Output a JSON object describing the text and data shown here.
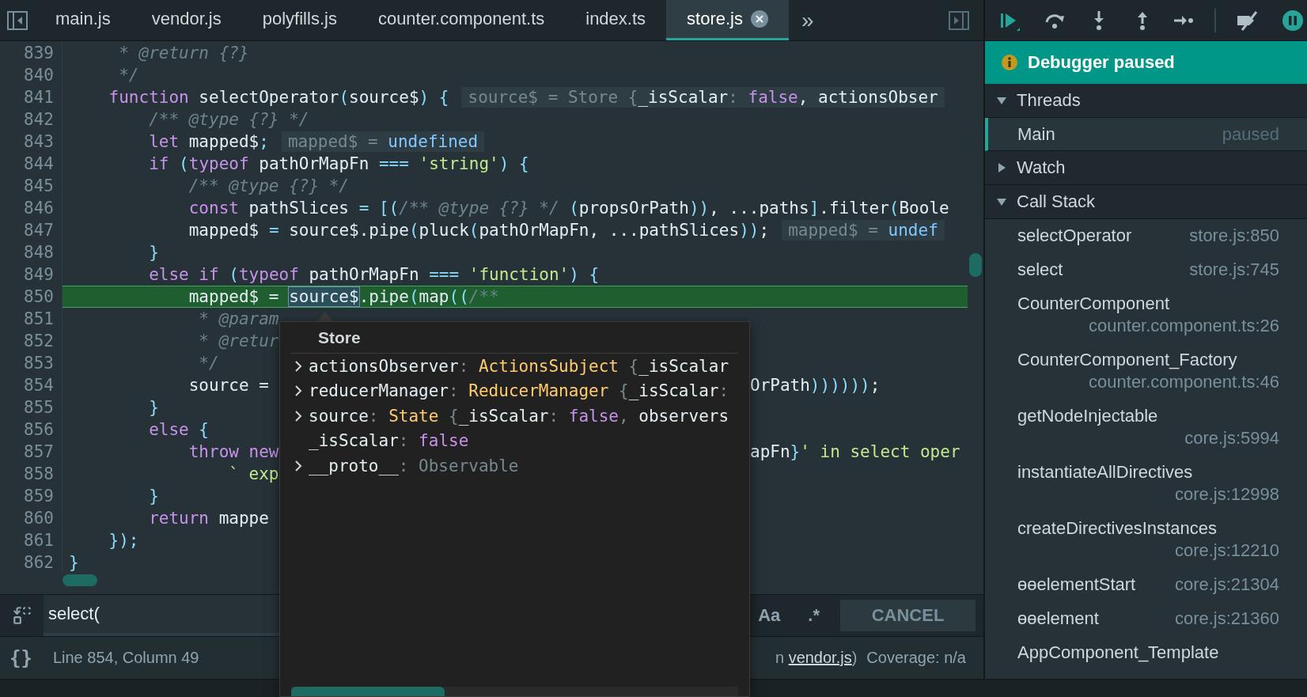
{
  "tabs": [
    {
      "label": "main.js",
      "selected": false,
      "closable": false
    },
    {
      "label": "vendor.js",
      "selected": false,
      "closable": false
    },
    {
      "label": "polyfills.js",
      "selected": false,
      "closable": false
    },
    {
      "label": "counter.component.ts",
      "selected": false,
      "closable": false
    },
    {
      "label": "index.ts",
      "selected": false,
      "closable": false
    },
    {
      "label": "store.js",
      "selected": true,
      "closable": true
    }
  ],
  "overflow_button": "»",
  "editor": {
    "lines": [
      {
        "number": "839",
        "highlighted": false,
        "tokens": [
          {
            "kind": "cm",
            "text": "     * @return {?}"
          }
        ]
      },
      {
        "number": "840",
        "highlighted": false,
        "tokens": [
          {
            "kind": "cm",
            "text": "     */"
          }
        ]
      },
      {
        "number": "841",
        "highlighted": false,
        "tokens": [
          {
            "kind": "kw",
            "text": "    function"
          },
          {
            "kind": "id",
            "text": " selectOperator"
          },
          {
            "kind": "p",
            "text": "("
          },
          {
            "kind": "id",
            "text": "source$"
          },
          {
            "kind": "p",
            "text": ") {"
          }
        ],
        "hint": [
          {
            "kind": "dim",
            "text": "source$ = Store {"
          },
          {
            "kind": "id",
            "text": "_isScalar"
          },
          {
            "kind": "dim",
            "text": ": "
          },
          {
            "kind": "kw",
            "text": "false"
          },
          {
            "kind": "id",
            "text": ", actionsObser"
          }
        ]
      },
      {
        "number": "842",
        "highlighted": false,
        "tokens": [
          {
            "kind": "cm",
            "text": "        /** @type {?} */"
          }
        ]
      },
      {
        "number": "843",
        "highlighted": false,
        "tokens": [
          {
            "kind": "kw",
            "text": "        let"
          },
          {
            "kind": "id",
            "text": " mapped$"
          },
          {
            "kind": "p",
            "text": ";"
          }
        ],
        "hint": [
          {
            "kind": "dim",
            "text": "mapped$ = "
          },
          {
            "kind": "lit",
            "text": "undefined"
          }
        ]
      },
      {
        "number": "844",
        "highlighted": false,
        "tokens": [
          {
            "kind": "kw",
            "text": "        if"
          },
          {
            "kind": "p",
            "text": " ("
          },
          {
            "kind": "kw",
            "text": "typeof"
          },
          {
            "kind": "id",
            "text": " pathOrMapFn "
          },
          {
            "kind": "p",
            "text": "==="
          },
          {
            "kind": "str",
            "text": " 'string'"
          },
          {
            "kind": "p",
            "text": ") {"
          }
        ]
      },
      {
        "number": "845",
        "highlighted": false,
        "tokens": [
          {
            "kind": "cm",
            "text": "            /** @type {?} */"
          }
        ]
      },
      {
        "number": "846",
        "highlighted": false,
        "tokens": [
          {
            "kind": "kw",
            "text": "            const"
          },
          {
            "kind": "id",
            "text": " pathSlices "
          },
          {
            "kind": "p",
            "text": "= [("
          },
          {
            "kind": "cm",
            "text": "/** @type {?} */"
          },
          {
            "kind": "p",
            "text": " ("
          },
          {
            "kind": "id",
            "text": "propsOrPath"
          },
          {
            "kind": "p",
            "text": "))"
          },
          {
            "kind": "id",
            "text": ", ...paths"
          },
          {
            "kind": "p",
            "text": "]"
          },
          {
            "kind": "id",
            "text": ".filter"
          },
          {
            "kind": "p",
            "text": "("
          },
          {
            "kind": "id",
            "text": "Boole"
          }
        ]
      },
      {
        "number": "847",
        "highlighted": false,
        "tokens": [
          {
            "kind": "id",
            "text": "            mapped$ "
          },
          {
            "kind": "p",
            "text": "="
          },
          {
            "kind": "id",
            "text": " source$.pipe"
          },
          {
            "kind": "p",
            "text": "("
          },
          {
            "kind": "id",
            "text": "pluck"
          },
          {
            "kind": "p",
            "text": "("
          },
          {
            "kind": "id",
            "text": "pathOrMapFn, ...pathSlices"
          },
          {
            "kind": "p",
            "text": "))"
          },
          {
            "kind": "id",
            "text": ";"
          }
        ],
        "hint": [
          {
            "kind": "dim",
            "text": "mapped$ = "
          },
          {
            "kind": "lit",
            "text": "undef"
          }
        ]
      },
      {
        "number": "848",
        "highlighted": false,
        "tokens": [
          {
            "kind": "p",
            "text": "        }"
          }
        ]
      },
      {
        "number": "849",
        "highlighted": false,
        "tokens": [
          {
            "kind": "kw",
            "text": "        else if"
          },
          {
            "kind": "p",
            "text": " ("
          },
          {
            "kind": "kw",
            "text": "typeof"
          },
          {
            "kind": "id",
            "text": " pathOrMapFn "
          },
          {
            "kind": "p",
            "text": "==="
          },
          {
            "kind": "str",
            "text": " 'function'"
          },
          {
            "kind": "p",
            "text": ") {"
          }
        ]
      },
      {
        "number": "850",
        "highlighted": true,
        "tokens": [
          {
            "kind": "id",
            "text": "            mapped$ = "
          },
          {
            "kind": "sel",
            "text": "source$"
          },
          {
            "kind": "id",
            "text": ".pipe"
          },
          {
            "kind": "p",
            "text": "("
          },
          {
            "kind": "id",
            "text": "map"
          },
          {
            "kind": "p",
            "text": "(("
          },
          {
            "kind": "cm",
            "text": "/**"
          }
        ]
      },
      {
        "number": "851",
        "highlighted": false,
        "tokens": [
          {
            "kind": "cm",
            "text": "             * @param"
          }
        ]
      },
      {
        "number": "852",
        "highlighted": false,
        "tokens": [
          {
            "kind": "cm",
            "text": "             * @retur"
          }
        ]
      },
      {
        "number": "853",
        "highlighted": false,
        "tokens": [
          {
            "kind": "cm",
            "text": "             */"
          }
        ]
      },
      {
        "number": "854",
        "highlighted": false,
        "tokens": [
          {
            "kind": "id",
            "text": "            source ="
          }
        ],
        "after": [
          {
            "kind": "id",
            "text": "OrPath"
          },
          {
            "kind": "p",
            "text": "))))))"
          },
          {
            "kind": "id",
            "text": ";"
          }
        ]
      },
      {
        "number": "855",
        "highlighted": false,
        "tokens": [
          {
            "kind": "p",
            "text": "        }"
          }
        ]
      },
      {
        "number": "856",
        "highlighted": false,
        "tokens": [
          {
            "kind": "kw",
            "text": "        else"
          },
          {
            "kind": "p",
            "text": " {"
          }
        ]
      },
      {
        "number": "857",
        "highlighted": false,
        "tokens": [
          {
            "kind": "kw",
            "text": "            throw new"
          }
        ],
        "after": [
          {
            "kind": "id",
            "text": "apFn"
          },
          {
            "kind": "p",
            "text": "}"
          },
          {
            "kind": "str",
            "text": "' in select oper"
          }
        ]
      },
      {
        "number": "858",
        "highlighted": false,
        "tokens": [
          {
            "kind": "str",
            "text": "                ` exp"
          }
        ]
      },
      {
        "number": "859",
        "highlighted": false,
        "tokens": [
          {
            "kind": "p",
            "text": "        }"
          }
        ]
      },
      {
        "number": "860",
        "highlighted": false,
        "tokens": [
          {
            "kind": "kw",
            "text": "        return"
          },
          {
            "kind": "id",
            "text": " mappe"
          }
        ]
      },
      {
        "number": "861",
        "highlighted": false,
        "tokens": [
          {
            "kind": "p",
            "text": "    });"
          }
        ]
      },
      {
        "number": "862",
        "highlighted": false,
        "tokens": [
          {
            "kind": "p",
            "text": "}"
          }
        ]
      }
    ]
  },
  "popup": {
    "title": "Store",
    "properties": [
      {
        "expandable": true,
        "tokens": [
          {
            "kind": "key",
            "text": "actionsObserver"
          },
          {
            "kind": "dim",
            "text": ": "
          },
          {
            "kind": "cls",
            "text": "ActionsSubject"
          },
          {
            "kind": "dim",
            "text": " {"
          },
          {
            "kind": "key",
            "text": "_isScalar"
          }
        ]
      },
      {
        "expandable": true,
        "tokens": [
          {
            "kind": "key",
            "text": "reducerManager"
          },
          {
            "kind": "dim",
            "text": ": "
          },
          {
            "kind": "cls",
            "text": "ReducerManager"
          },
          {
            "kind": "dim",
            "text": " {"
          },
          {
            "kind": "key",
            "text": "_isScalar"
          },
          {
            "kind": "dim",
            "text": ":"
          }
        ]
      },
      {
        "expandable": true,
        "tokens": [
          {
            "kind": "key",
            "text": "source"
          },
          {
            "kind": "dim",
            "text": ": "
          },
          {
            "kind": "cls",
            "text": "State"
          },
          {
            "kind": "dim",
            "text": " {"
          },
          {
            "kind": "key",
            "text": "_isScalar"
          },
          {
            "kind": "dim",
            "text": ": "
          },
          {
            "kind": "kw",
            "text": "false"
          },
          {
            "kind": "dim",
            "text": ", "
          },
          {
            "kind": "key",
            "text": "observers"
          }
        ]
      },
      {
        "expandable": false,
        "tokens": [
          {
            "kind": "key",
            "text": "_isScalar"
          },
          {
            "kind": "dim",
            "text": ": "
          },
          {
            "kind": "kw",
            "text": "false"
          }
        ]
      },
      {
        "expandable": true,
        "tokens": [
          {
            "kind": "key",
            "text": "__proto__"
          },
          {
            "kind": "dim",
            "text": ": Observable"
          }
        ]
      }
    ]
  },
  "search": {
    "value": "select(",
    "case_button": "Aa",
    "regex_button": ".*",
    "cancel_button": "CANCEL"
  },
  "status": {
    "format_button": "{}",
    "position": "Line 854, Column 49",
    "source_prefix": "n",
    "source_link": "vendor.js",
    "source_suffix": ")",
    "coverage": "Coverage: n/a"
  },
  "debugger": {
    "banner": "Debugger paused",
    "sections": [
      {
        "title": "Threads",
        "expanded": true,
        "threads": [
          {
            "name": "Main",
            "status": "paused",
            "selected": true
          }
        ]
      },
      {
        "title": "Watch",
        "expanded": false
      },
      {
        "title": "Call Stack",
        "expanded": true,
        "frames": [
          {
            "name": "selectOperator",
            "location": "store.js:850"
          },
          {
            "name": "select",
            "location": "store.js:745"
          },
          {
            "name": "CounterComponent",
            "location": "counter.component.ts:26"
          },
          {
            "name": "CounterComponent_Factory",
            "location": "counter.component.ts:46"
          },
          {
            "name": "getNodeInjectable",
            "location": "core.js:5994"
          },
          {
            "name": "instantiateAllDirectives",
            "location": "core.js:12998"
          },
          {
            "name": "createDirectivesInstances",
            "location": "core.js:12210"
          },
          {
            "name": "ɵɵelementStart",
            "location": "core.js:21304"
          },
          {
            "name": "ɵɵelement",
            "location": "core.js:21360"
          },
          {
            "name": "AppComponent_Template"
          }
        ]
      }
    ]
  }
}
